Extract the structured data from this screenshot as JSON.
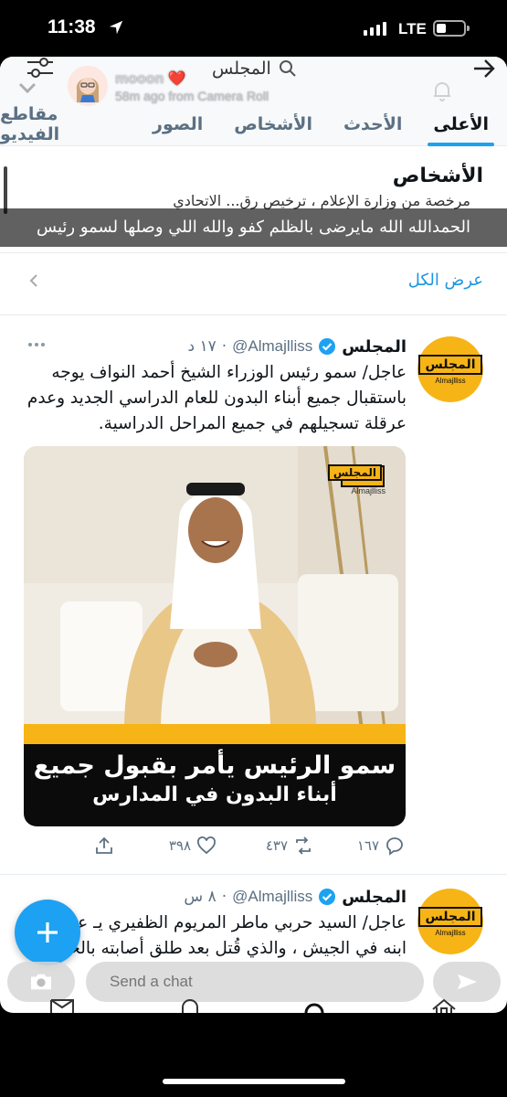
{
  "status_bar": {
    "time": "11:38",
    "network": "LTE"
  },
  "snap": {
    "username": "mooon",
    "subtitle": "58m ago from Camera Roll",
    "chat_placeholder": "Send a chat"
  },
  "header": {
    "search_text": "المجلس"
  },
  "tabs": [
    {
      "label": "الأعلى",
      "active": true
    },
    {
      "label": "الأحدث",
      "active": false
    },
    {
      "label": "الأشخاص",
      "active": false
    },
    {
      "label": "الصور",
      "active": false
    },
    {
      "label": "مقاطع الفيديو",
      "active": false
    }
  ],
  "people": {
    "title": "الأشخاص",
    "cut_text": "مرخصة من وزارة الإعلام ، ترخيص رق...          الاتحادي",
    "caption_overlay": "الحمدالله الله مايرضى بالظلم كفو والله اللي وصلها لسمو رئيس",
    "show_all": "عرض الكل"
  },
  "tweets": [
    {
      "name": "المجلس",
      "handle": "@Almajlliss",
      "time": "١٧ د",
      "avatar_text": "المجلس",
      "avatar_text_en": "Almajlliss",
      "text": "عاجل/ سمو رئيس الوزراء الشيخ أحمد النواف يوجه باستقبال جميع أبناء البدون للعام الدراسي الجديد وعدم عرقلة تسجيلهم في جميع المراحل الدراسية.",
      "media_caption_1": "سمو الرئيس يأمر بقبول جميع",
      "media_caption_2": "أبناء البدون في المدارس",
      "media_logo": "المجلس",
      "media_logo_en": "Almajlliss",
      "replies": "١٦٧",
      "retweets": "٤٣٧",
      "likes": "٣٩٨"
    },
    {
      "name": "المجلس",
      "handle": "@Almajlliss",
      "time": "٨ س",
      "avatar_text": "المجلس",
      "avatar_text_en": "Almajlliss",
      "text": "عاجل/ السيد حربي ماطر المريوم الظفيري يـ عن قاتل ابنه في الجيش ، والذي قُتل بعد طلق أصابته بالخطأ من زميله فيصل بستان العنزي قبل"
    }
  ],
  "colors": {
    "accent": "#1da1f2",
    "brand_yellow": "#f7b416",
    "link": "#1b95e0"
  },
  "icons": [
    "filter-icon",
    "search-icon",
    "back-arrow-icon",
    "bell-icon",
    "chevron-down-icon",
    "verified-icon",
    "more-icon",
    "reply-icon",
    "retweet-icon",
    "like-icon",
    "share-icon",
    "camera-icon",
    "send-icon",
    "plus-icon",
    "location-icon"
  ]
}
